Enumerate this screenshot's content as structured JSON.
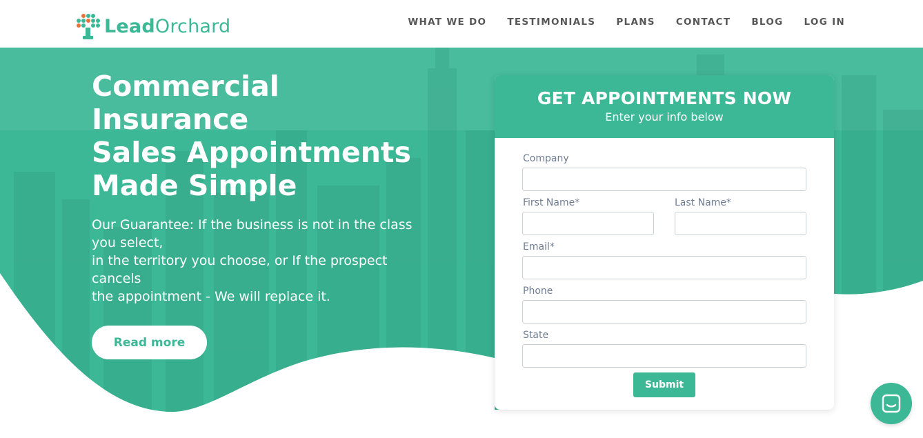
{
  "brand": {
    "name_bold": "Lead",
    "name_regular": "Orchard",
    "color": "#3db897"
  },
  "nav": {
    "items": [
      {
        "label": "WHAT WE DO"
      },
      {
        "label": "TESTIMONIALS"
      },
      {
        "label": "PLANS"
      },
      {
        "label": "CONTACT"
      },
      {
        "label": "BLOG"
      },
      {
        "label": "LOG IN"
      }
    ]
  },
  "hero": {
    "headline_lines": [
      "Commercial",
      "Insurance",
      "Sales Appointments",
      "Made Simple"
    ],
    "guarantee_lines": [
      "Our Guarantee: If the business is not in the class",
      "you select,",
      "in the territory you choose, or If the prospect",
      "cancels",
      "the appointment - We will replace it."
    ],
    "read_more_label": "Read more"
  },
  "form": {
    "title": "GET APPOINTMENTS NOW",
    "subtitle": "Enter your info below",
    "fields": {
      "company": {
        "label": "Company",
        "value": ""
      },
      "first_name": {
        "label": "First Name*",
        "value": ""
      },
      "last_name": {
        "label": "Last Name*",
        "value": ""
      },
      "email": {
        "label": "Email*",
        "value": ""
      },
      "phone": {
        "label": "Phone",
        "value": ""
      },
      "state": {
        "label": "State",
        "value": ""
      }
    },
    "submit_label": "Submit"
  },
  "chat": {
    "icon": "chat-bubble-icon"
  },
  "colors": {
    "accent": "#3db897",
    "hero_overlay": "#3db897",
    "nav_text": "#575757",
    "label_text": "#6f7d93"
  }
}
